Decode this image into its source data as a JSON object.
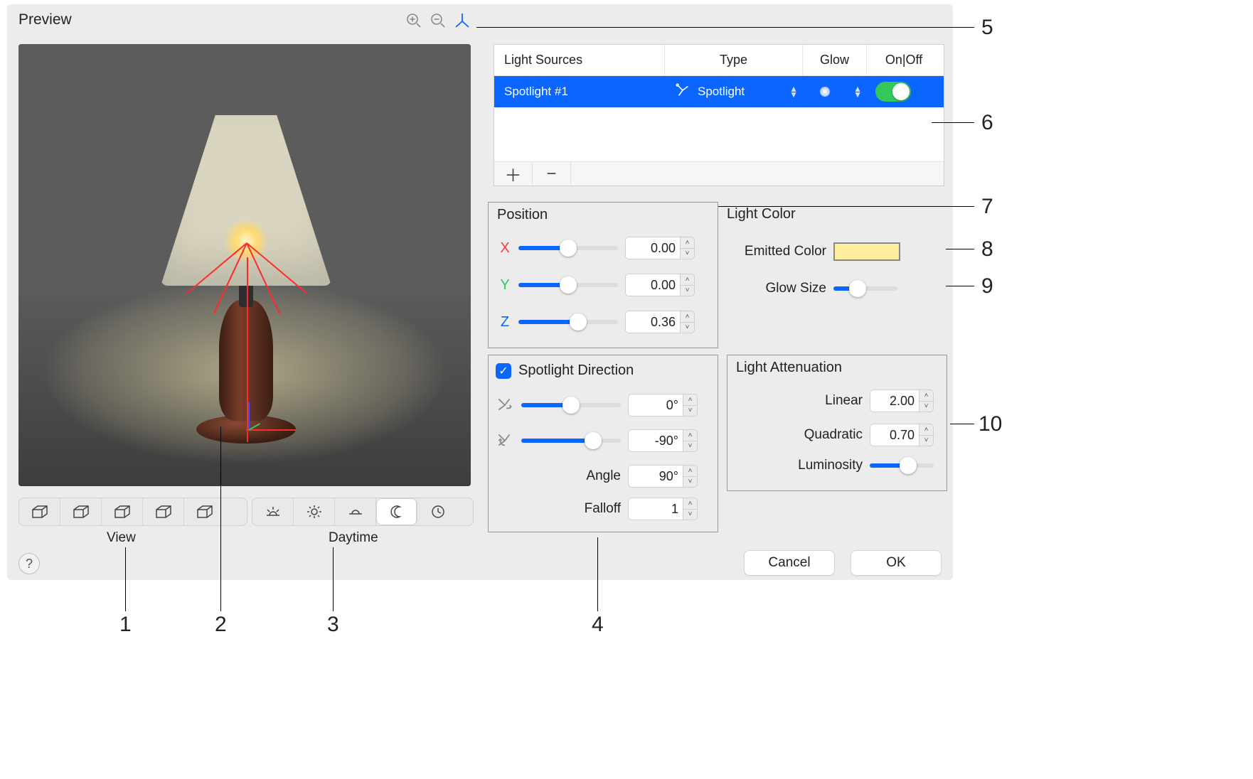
{
  "preview": {
    "title": "Preview",
    "view_label": "View",
    "daytime_label": "Daytime"
  },
  "view_icons": [
    "cube",
    "cube",
    "cube",
    "cube",
    "cube"
  ],
  "daytime_icons": [
    "sunrise",
    "sun",
    "sunset",
    "moon",
    "clock"
  ],
  "table": {
    "columns": {
      "sources": "Light Sources",
      "type": "Type",
      "glow": "Glow",
      "onoff": "On|Off"
    },
    "row": {
      "name": "Spotlight #1",
      "type": "Spotlight",
      "on": true
    }
  },
  "position": {
    "title": "Position",
    "x": {
      "label": "X",
      "value": "0.00",
      "fill": 50
    },
    "y": {
      "label": "Y",
      "value": "0.00",
      "fill": 50
    },
    "z": {
      "label": "Z",
      "value": "0.36",
      "fill": 60
    }
  },
  "light_color": {
    "title": "Light Color",
    "emitted_label": "Emitted Color",
    "emitted_value": "#ffee9e",
    "glow_size_label": "Glow Size",
    "glow_size_fill": 38
  },
  "spotlight": {
    "title": "Spotlight Direction",
    "checked": true,
    "azimuth": {
      "value": "0°",
      "fill": 50
    },
    "elevation": {
      "value": "-90°",
      "fill": 72
    },
    "angle_label": "Angle",
    "angle_value": "90°",
    "falloff_label": "Falloff",
    "falloff_value": "1"
  },
  "attenuation": {
    "title": "Light Attenuation",
    "linear_label": "Linear",
    "linear_value": "2.00",
    "quadratic_label": "Quadratic",
    "quadratic_value": "0.70",
    "luminosity_label": "Luminosity",
    "luminosity_fill": 60
  },
  "buttons": {
    "cancel": "Cancel",
    "ok": "OK"
  },
  "callouts": [
    "1",
    "2",
    "3",
    "4",
    "5",
    "6",
    "7",
    "8",
    "9",
    "10"
  ]
}
